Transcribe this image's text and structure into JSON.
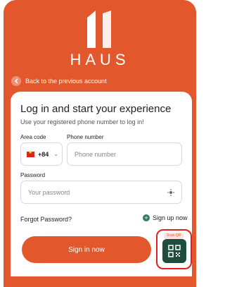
{
  "brand": {
    "name": "HAUS"
  },
  "back": {
    "label": "Back to the previous account",
    "icon": "chevron-left-icon"
  },
  "form": {
    "title": "Log in and start your experience",
    "subtitle": "Use your registered phone number to log in!",
    "area_code_label": "Area code",
    "area_code_value": "+84",
    "phone_label": "Phone number",
    "phone_placeholder": "Phone number",
    "password_label": "Password",
    "password_placeholder": "Your password",
    "forgot": "Forgot Password?",
    "signup": "Sign up now",
    "signin": "Sign in now",
    "scan_qr": "Scan QR"
  },
  "colors": {
    "accent": "#e2572b",
    "qr_tile": "#1f4d3d",
    "highlight": "#e0201c"
  }
}
